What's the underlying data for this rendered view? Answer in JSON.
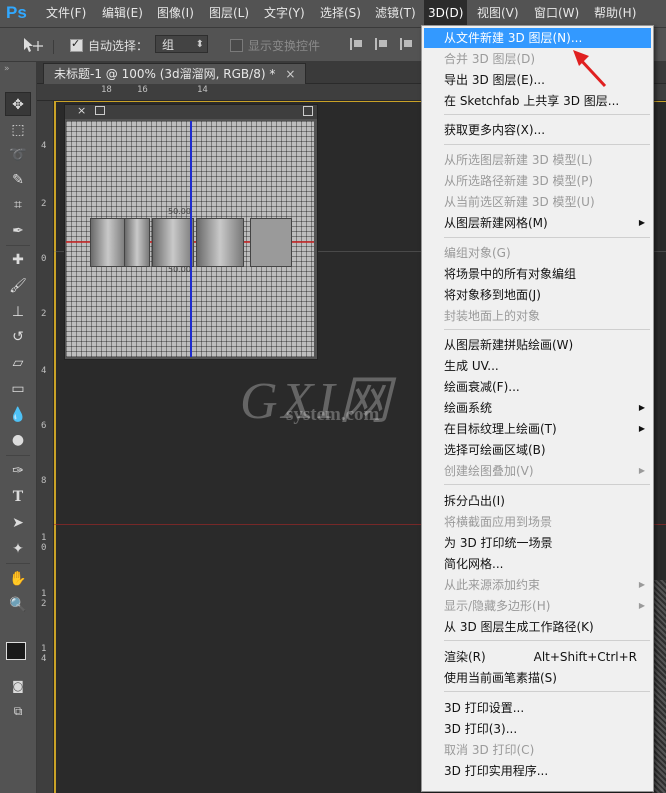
{
  "app": {
    "logo": "Ps"
  },
  "menubar": {
    "items": [
      {
        "label": "文件(F)"
      },
      {
        "label": "编辑(E)"
      },
      {
        "label": "图像(I)"
      },
      {
        "label": "图层(L)"
      },
      {
        "label": "文字(Y)"
      },
      {
        "label": "选择(S)"
      },
      {
        "label": "滤镜(T)"
      },
      {
        "label": "3D(D)"
      },
      {
        "label": "视图(V)"
      },
      {
        "label": "窗口(W)"
      },
      {
        "label": "帮助(H)"
      }
    ],
    "active": "3D(D)"
  },
  "options": {
    "auto_select_label": "自动选择：",
    "auto_select_checked": true,
    "auto_select_value": "组",
    "show_transform_label": "显示变换控件"
  },
  "document": {
    "tab_title": "未标题-1 @ 100% (3d溜溜网, RGB/8) *",
    "close": "×"
  },
  "rulers": {
    "top": [
      "18",
      "16",
      "14"
    ],
    "left": [
      "4",
      "2",
      "0",
      "2",
      "4",
      "6",
      "8",
      "1 0",
      "1 2",
      "1 4"
    ]
  },
  "panel3d": {
    "labels": [
      "50.00",
      "50.00"
    ]
  },
  "watermark": {
    "big": "GXI网",
    "small": "system.com"
  },
  "dropdown": {
    "items": [
      {
        "label": "从文件新建 3D 图层(N)...",
        "state": "highlight"
      },
      {
        "label": "合并 3D 图层(D)",
        "state": "disabled"
      },
      {
        "label": "导出 3D 图层(E)...",
        "state": "normal"
      },
      {
        "label": "在 Sketchfab 上共享 3D 图层...",
        "state": "normal"
      },
      {
        "sep": true
      },
      {
        "label": "获取更多内容(X)...",
        "state": "normal"
      },
      {
        "sep": true
      },
      {
        "label": "从所选图层新建 3D 模型(L)",
        "state": "disabled"
      },
      {
        "label": "从所选路径新建 3D 模型(P)",
        "state": "disabled"
      },
      {
        "label": "从当前选区新建 3D 模型(U)",
        "state": "disabled"
      },
      {
        "label": "从图层新建网格(M)",
        "state": "normal",
        "submenu": true
      },
      {
        "sep": true
      },
      {
        "label": "编组对象(G)",
        "state": "disabled"
      },
      {
        "label": "将场景中的所有对象编组",
        "state": "normal"
      },
      {
        "label": "将对象移到地面(J)",
        "state": "normal"
      },
      {
        "label": "封装地面上的对象",
        "state": "disabled"
      },
      {
        "sep": true
      },
      {
        "label": "从图层新建拼贴绘画(W)",
        "state": "normal"
      },
      {
        "label": "生成 UV...",
        "state": "normal"
      },
      {
        "label": "绘画衰减(F)...",
        "state": "normal"
      },
      {
        "label": "绘画系统",
        "state": "normal",
        "submenu": true
      },
      {
        "label": "在目标纹理上绘画(T)",
        "state": "normal",
        "submenu": true
      },
      {
        "label": "选择可绘画区域(B)",
        "state": "normal"
      },
      {
        "label": "创建绘图叠加(V)",
        "state": "disabled",
        "submenu": true
      },
      {
        "sep": true
      },
      {
        "label": "拆分凸出(I)",
        "state": "normal"
      },
      {
        "label": "将横截面应用到场景",
        "state": "disabled"
      },
      {
        "label": "为 3D 打印统一场景",
        "state": "normal"
      },
      {
        "label": "简化网格...",
        "state": "normal"
      },
      {
        "label": "从此来源添加约束",
        "state": "disabled",
        "submenu": true
      },
      {
        "label": "显示/隐藏多边形(H)",
        "state": "disabled",
        "submenu": true
      },
      {
        "label": "从 3D 图层生成工作路径(K)",
        "state": "normal"
      },
      {
        "sep": true
      },
      {
        "label": "渲染(R)",
        "state": "normal",
        "shortcut": "Alt+Shift+Ctrl+R"
      },
      {
        "label": "使用当前画笔素描(S)",
        "state": "normal"
      },
      {
        "sep": true
      },
      {
        "label": "3D 打印设置...",
        "state": "normal"
      },
      {
        "label": "3D 打印(3)...",
        "state": "normal"
      },
      {
        "label": "取消 3D 打印(C)",
        "state": "disabled"
      },
      {
        "label": "3D 打印实用程序...",
        "state": "normal"
      }
    ]
  },
  "colors": {
    "highlight": "#3399ff",
    "foreground_swatch": "#1a1a1a",
    "background_swatch": "#f2f20a",
    "canvas_guide": "#c9a227",
    "pointer_arrow": "#e02020"
  }
}
